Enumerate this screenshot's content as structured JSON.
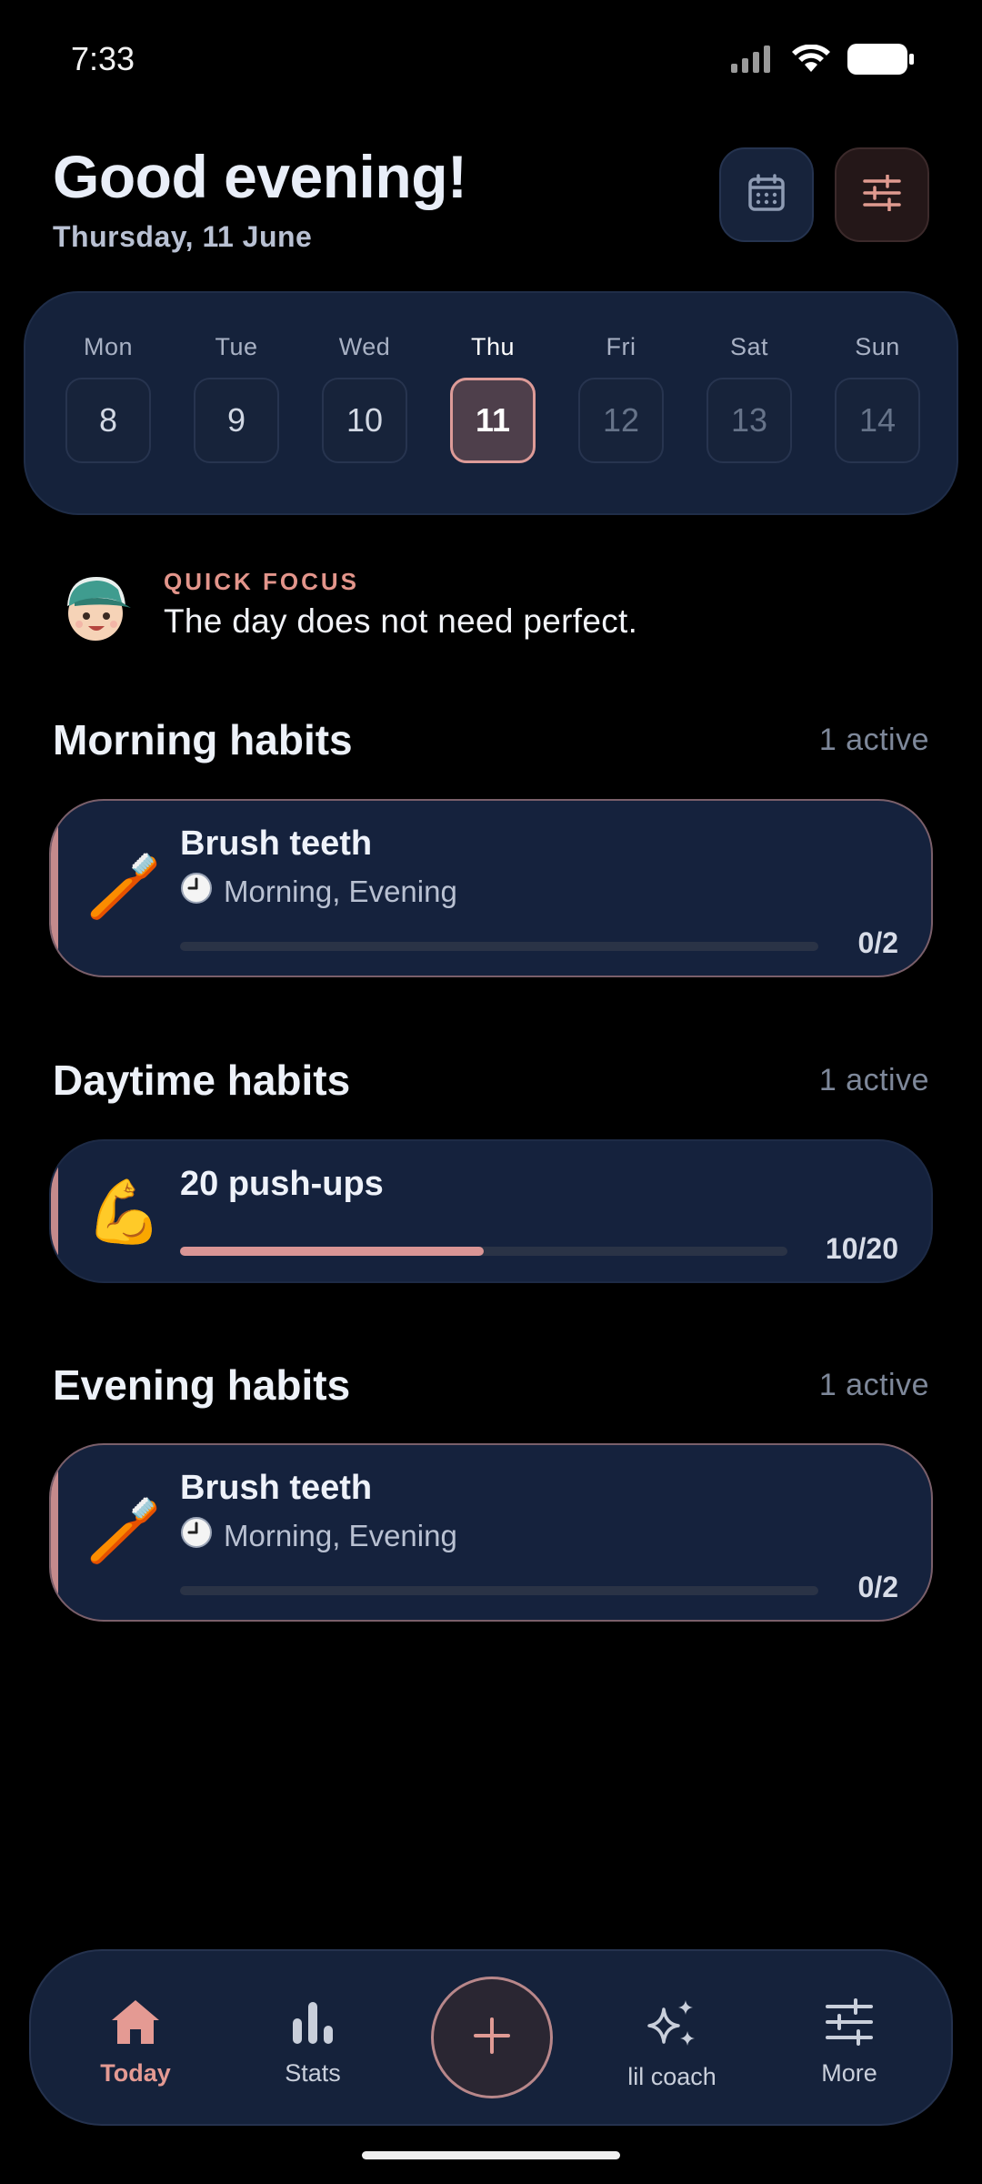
{
  "status": {
    "time": "7:33"
  },
  "header": {
    "greeting": "Good evening!",
    "date": "Thursday, 11 June"
  },
  "week": [
    {
      "name": "Mon",
      "num": "8"
    },
    {
      "name": "Tue",
      "num": "9"
    },
    {
      "name": "Wed",
      "num": "10"
    },
    {
      "name": "Thu",
      "num": "11"
    },
    {
      "name": "Fri",
      "num": "12"
    },
    {
      "name": "Sat",
      "num": "13"
    },
    {
      "name": "Sun",
      "num": "14"
    }
  ],
  "focus": {
    "label": "QUICK FOCUS",
    "text": "The day does not need perfect."
  },
  "sections": {
    "morning": {
      "title": "Morning habits",
      "count": "1 active"
    },
    "daytime": {
      "title": "Daytime habits",
      "count": "1 active"
    },
    "evening": {
      "title": "Evening habits",
      "count": "1 active"
    }
  },
  "habits": {
    "morning": {
      "emoji": "🪥",
      "title": "Brush teeth",
      "times": "Morning, Evening",
      "count": "0/2",
      "progress": 0
    },
    "daytime": {
      "emoji": "💪",
      "title": "20 push-ups",
      "count": "10/20",
      "progress": 0.5
    },
    "evening": {
      "emoji": "🪥",
      "title": "Brush teeth",
      "times": "Morning, Evening",
      "count": "0/2",
      "progress": 0
    }
  },
  "nav": {
    "today": "Today",
    "stats": "Stats",
    "coach": "lil coach",
    "more": "More"
  },
  "colors": {
    "accent": "#e49a93",
    "card": "#15223d",
    "background": "#000000"
  }
}
